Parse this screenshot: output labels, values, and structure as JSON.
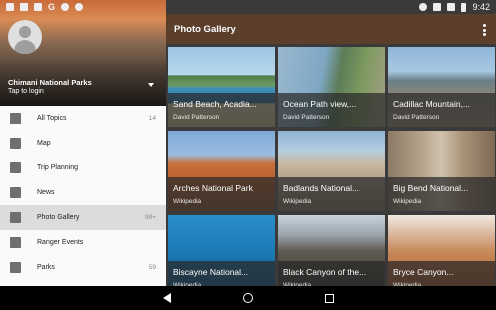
{
  "status_bar": {
    "time": "9:42",
    "left_icons": [
      "image-notification-icon",
      "chat-notification-icon",
      "navigation-icon",
      "google-icon",
      "location-icon",
      "timer-icon"
    ],
    "google_glyph": "G",
    "right_icons": [
      "location-icon",
      "wifi-icon",
      "signal-icon",
      "battery-icon"
    ]
  },
  "drawer": {
    "account_name": "Chimani National Parks",
    "account_sub": "Tap to login",
    "items": [
      {
        "label": "All Topics",
        "count": "14",
        "icon": "grid-icon"
      },
      {
        "label": "Map",
        "count": "",
        "icon": "map-icon"
      },
      {
        "label": "Trip Planning",
        "count": "",
        "icon": "luggage-icon"
      },
      {
        "label": "News",
        "count": "",
        "icon": "newspaper-icon"
      },
      {
        "label": "Photo Gallery",
        "count": "99+",
        "icon": "photo-icon"
      },
      {
        "label": "Ranger Events",
        "count": "",
        "icon": "ranger-icon"
      },
      {
        "label": "Parks",
        "count": "59",
        "icon": "trees-icon"
      }
    ]
  },
  "appbar": {
    "title": "Photo Gallery"
  },
  "gallery": {
    "tiles": [
      {
        "title": "Sand Beach, Acadia...",
        "sub": "David Patterson"
      },
      {
        "title": "Ocean Path view,...",
        "sub": "David Patterson"
      },
      {
        "title": "Cadillac Mountain,...",
        "sub": "David Patterson"
      },
      {
        "title": "Arches National Park",
        "sub": "Wikipedia"
      },
      {
        "title": "Badlands National...",
        "sub": "Wikipedia"
      },
      {
        "title": "Big Bend National...",
        "sub": "Wikipedia"
      },
      {
        "title": "Biscayne National...",
        "sub": "Wikipedia"
      },
      {
        "title": "Black Canyon of the...",
        "sub": "Wikipedia"
      },
      {
        "title": "Bryce Canyon...",
        "sub": "Wikipedia"
      }
    ]
  },
  "colors": {
    "appbar": "#5b3f2b",
    "drawer_bg": "#fafafa",
    "active_item": "#dcdcdc"
  }
}
